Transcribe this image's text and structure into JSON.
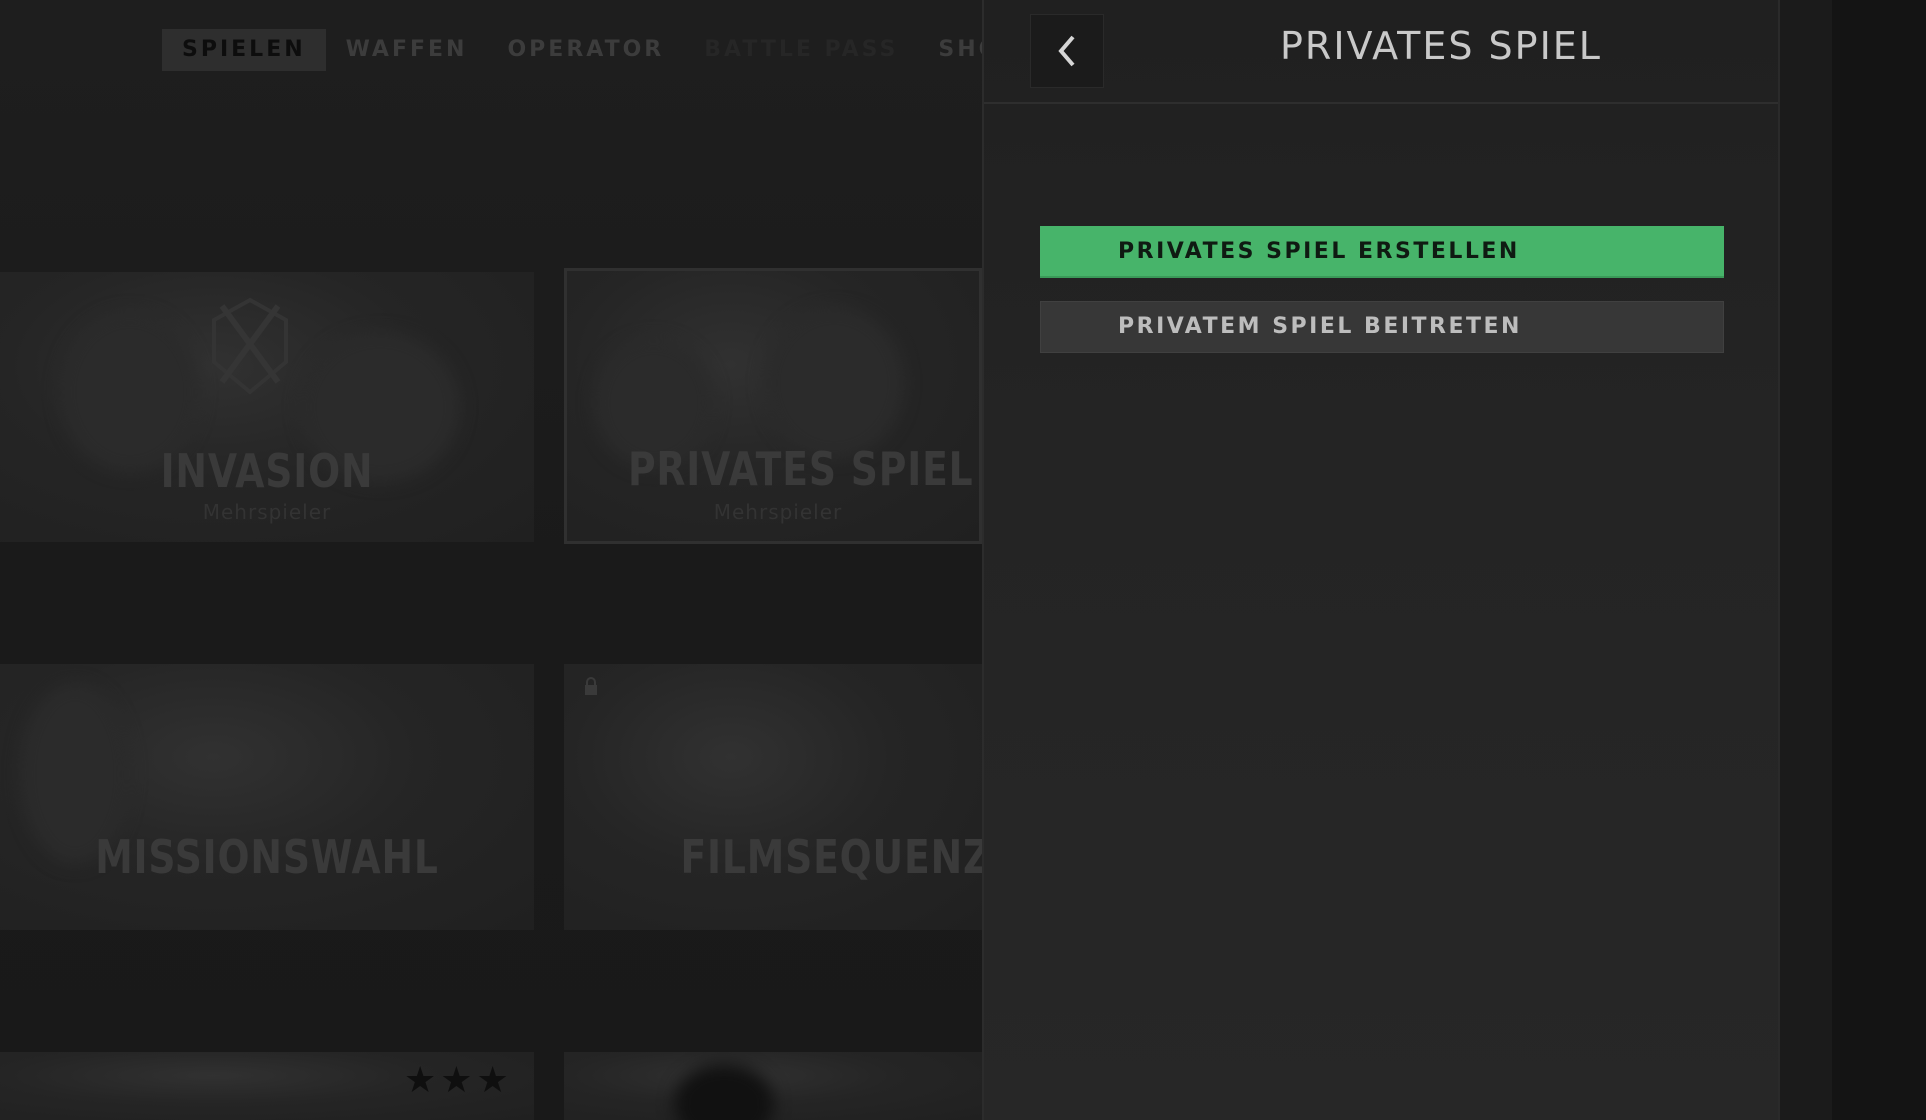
{
  "top_nav": {
    "tabs": [
      {
        "label": "SPIELEN"
      },
      {
        "label": "WAFFEN"
      },
      {
        "label": "OPERATOR"
      },
      {
        "label": "BATTLE PASS"
      },
      {
        "label": "SHOP"
      }
    ]
  },
  "cards": {
    "invasion": {
      "title": "INVASION",
      "subtitle": "Mehrspieler"
    },
    "private_match": {
      "title": "PRIVATES SPIEL",
      "subtitle": "Mehrspieler"
    },
    "mission_select": {
      "title": "MISSIONSWAHL"
    },
    "cutscenes": {
      "title": "FILMSEQUENZEN"
    }
  },
  "panel": {
    "title": "PRIVATES SPIEL",
    "buttons": {
      "create": "PRIVATES SPIEL ERSTELLEN",
      "join": "PRIVATEM SPIEL BEITRETEN"
    }
  },
  "icons": {
    "back": "chevron-left-icon",
    "lock": "lock-icon",
    "stars": "star-icon"
  },
  "colors": {
    "accent_green": "#47b46a",
    "panel_bg": "#242424",
    "title_text": "#c9c9c9"
  }
}
